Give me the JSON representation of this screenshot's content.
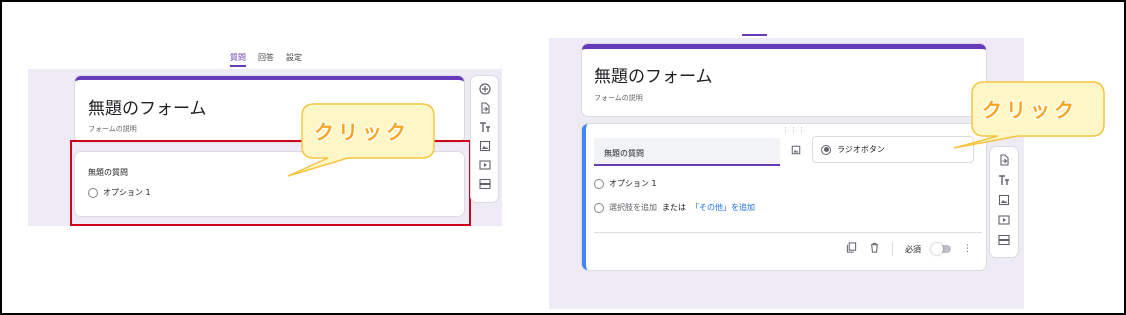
{
  "left": {
    "tabs": [
      {
        "label": "質問",
        "active": true
      },
      {
        "label": "回答",
        "active": false
      },
      {
        "label": "設定",
        "active": false
      }
    ],
    "form_title": "無題のフォーム",
    "form_description": "フォームの説明",
    "question_title": "無題の質問",
    "option_label": "オプション 1",
    "toolbar_icons": [
      "add-question-icon",
      "import-questions-icon",
      "add-title-icon",
      "add-image-icon",
      "add-video-icon",
      "add-section-icon"
    ]
  },
  "right": {
    "form_title": "無題のフォーム",
    "form_description": "フォームの説明",
    "question_placeholder": "無題の質問",
    "question_type": "ラジオボタン",
    "option_label": "オプション 1",
    "add_option": "選択肢を追加",
    "or_label": "または",
    "add_other": "「その他」を追加",
    "required_label": "必須",
    "required": false,
    "toolbar_icons": [
      "import-questions-icon",
      "add-title-icon",
      "add-image-icon",
      "add-video-icon",
      "add-section-icon"
    ]
  },
  "callouts": {
    "left_text": "クリック",
    "right_text": "クリック"
  },
  "colors": {
    "accent": "#673ab7",
    "highlight_box": "#d0021b",
    "callout_fill": "#fdf7c8",
    "callout_stroke": "#f5c542",
    "callout_text": "#f5a623",
    "focus_bar": "#4285f4",
    "link": "#1a73e8"
  }
}
